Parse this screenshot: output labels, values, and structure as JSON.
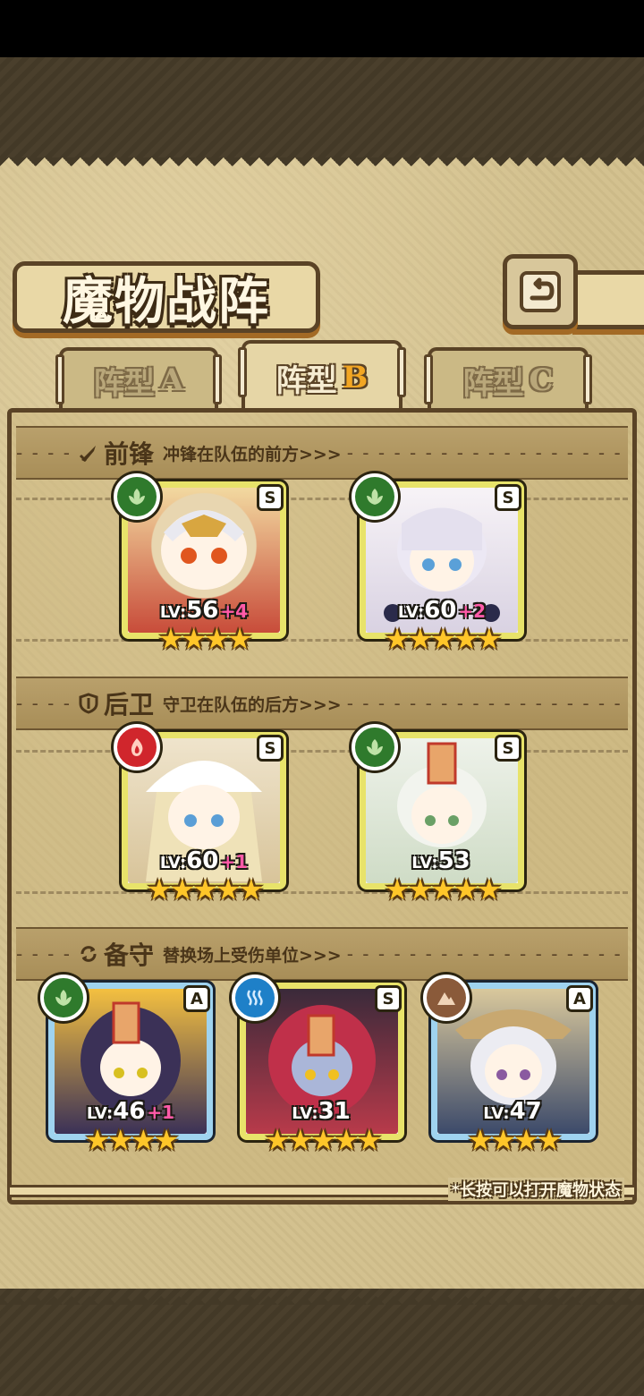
{
  "title": "魔物战阵",
  "tabs": [
    {
      "label": "阵型",
      "letter": "A",
      "active": false
    },
    {
      "label": "阵型",
      "letter": "B",
      "active": true
    },
    {
      "label": "阵型",
      "letter": "C",
      "active": false
    }
  ],
  "sections": {
    "front": {
      "title": "前锋",
      "desc": "冲锋在队伍的前方>>>",
      "icon": "sword-icon"
    },
    "back": {
      "title": "后卫",
      "desc": "守卫在队伍的后方>>>",
      "icon": "shield-icon"
    },
    "reserve": {
      "title": "备守",
      "desc": "替换场上受伤单位>>>",
      "icon": "swap-icon"
    }
  },
  "cards": {
    "f1": {
      "rank": "S",
      "element": "leaf",
      "lv_label": "LV:",
      "level": "56",
      "plus": "+4",
      "stars": "★★★★"
    },
    "f2": {
      "rank": "S",
      "element": "leaf",
      "lv_label": "LV:",
      "level": "60",
      "plus": "+2",
      "stars": "★★★★★"
    },
    "b1": {
      "rank": "S",
      "element": "fire",
      "lv_label": "LV:",
      "level": "60",
      "plus": "+1",
      "stars": "★★★★★"
    },
    "b2": {
      "rank": "S",
      "element": "leaf",
      "lv_label": "LV:",
      "level": "53",
      "plus": "",
      "stars": "★★★★★"
    },
    "r1": {
      "rank": "A",
      "element": "leaf",
      "lv_label": "LV:",
      "level": "46",
      "plus": "+1",
      "stars": "★★★★"
    },
    "r2": {
      "rank": "S",
      "element": "water",
      "lv_label": "LV:",
      "level": "31",
      "plus": "",
      "stars": "★★★★★"
    },
    "r3": {
      "rank": "A",
      "element": "earth",
      "lv_label": "LV:",
      "level": "47",
      "plus": "",
      "stars": "★★★★"
    }
  },
  "hint": "*长按可以打开魔物状态",
  "colors": {
    "leaf": "#2f7a2c",
    "fire": "#d0262c",
    "water": "#1e80c8",
    "earth": "#8a5a3a",
    "gold_star": "#ffc629"
  }
}
